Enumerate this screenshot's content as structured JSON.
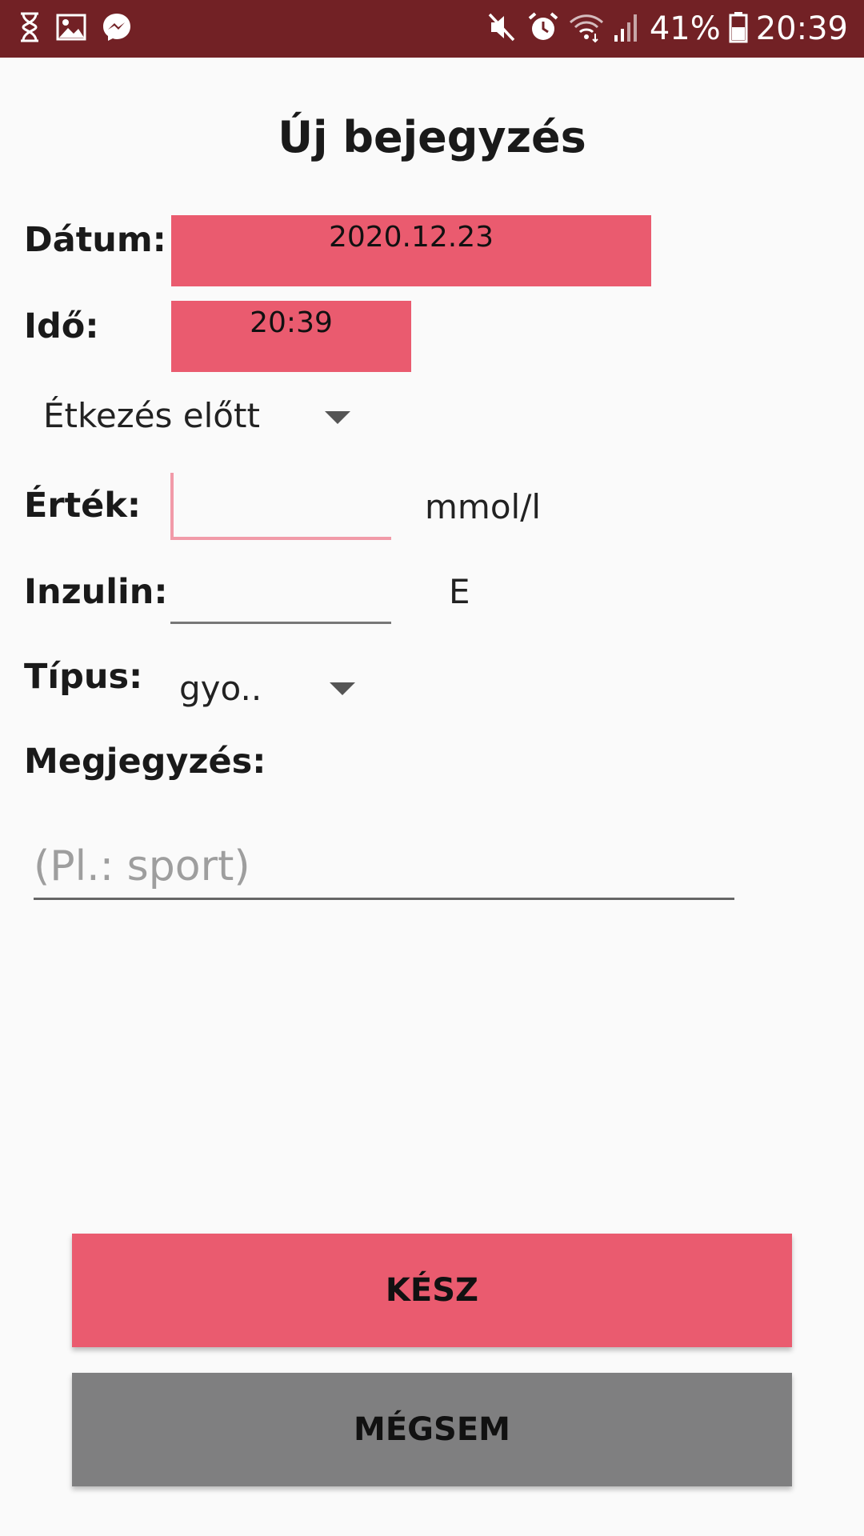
{
  "status_bar": {
    "left_icons": [
      "hourglass-icon",
      "image-icon",
      "messenger-icon"
    ],
    "right_icons": [
      "mute-icon",
      "alarm-icon",
      "wifi-icon",
      "signal-icon",
      "battery-icon"
    ],
    "battery": "41%",
    "time": "20:39",
    "color": "#722125"
  },
  "title": "Új bejegyzés",
  "date": {
    "label": "Dátum:",
    "value": "2020.12.23"
  },
  "time_field": {
    "label": "Idő:",
    "value": "20:39"
  },
  "meal": {
    "selected": "Étkezés előtt"
  },
  "value": {
    "label": "Érték:",
    "unit": "mmol/l",
    "current": ""
  },
  "insulin": {
    "label": "Inzulin:",
    "unit": "E",
    "current": ""
  },
  "type": {
    "label": "Típus:",
    "selected": "gyo.."
  },
  "note": {
    "label": "Megjegyzés:",
    "placeholder": "(Pl.: sport)"
  },
  "buttons": {
    "done": "KÉSZ",
    "cancel": "MÉGSEM"
  },
  "colors": {
    "accent": "#ea5b6f",
    "cancel": "#7f7f80",
    "focus": "#f19aa8"
  }
}
